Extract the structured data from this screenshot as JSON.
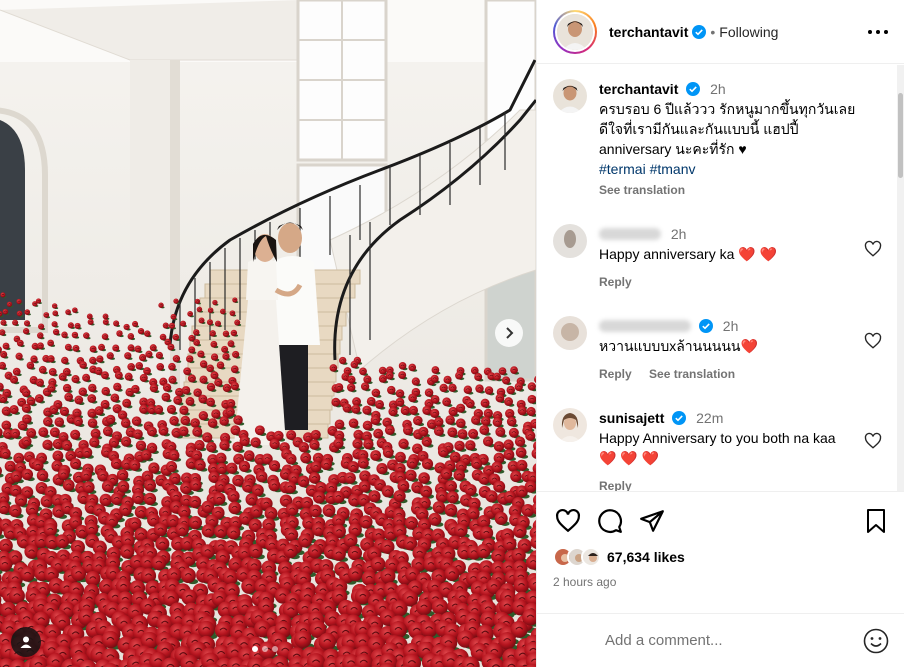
{
  "post_author": {
    "username": "terchantavit",
    "follow_status": "Following",
    "separator": "•"
  },
  "caption": {
    "username": "terchantavit",
    "time": "2h",
    "text_line1": "ครบรอบ 6 ปีแล้ววว รักหนูมากขึ้นทุกวันเลย",
    "text_line2": "ดีใจที่เรามีกันและกันแบบนี้ แฮปปี้",
    "text_line3": "anniversary นะคะที่รัก ♥",
    "hashtags": "#termai #tmanv",
    "see_translation": "See translation"
  },
  "comments": [
    {
      "time": "2h",
      "text": "Happy anniversary ka",
      "emoji": "❤️ ❤️",
      "reply": "Reply"
    },
    {
      "time": "2h",
      "text": "หวานแบบบxล้านนนนน",
      "emoji": "❤️",
      "reply": "Reply",
      "see_translation": "See translation"
    },
    {
      "username": "sunisajett",
      "time": "22m",
      "text": "Happy Anniversary to you both na kaa",
      "emoji": "❤️ ❤️ ❤️",
      "reply": "Reply"
    }
  ],
  "engagement": {
    "likes": "67,634 likes",
    "posted_ago": "2 hours ago"
  },
  "add_comment": {
    "placeholder": "Add a comment..."
  },
  "icons": {
    "verified": "verified-badge-icon",
    "more": "more-options-icon",
    "like": "heart-icon",
    "comment": "comment-icon",
    "share": "paper-plane-icon",
    "save": "bookmark-icon",
    "emoji": "emoji-icon",
    "next": "chevron-right-icon",
    "tag": "user-tag-icon"
  },
  "colors": {
    "verified_blue": "#0095f6",
    "hashtag_blue": "#00376b",
    "heart_red": "#e0152d",
    "muted_text": "#737373"
  }
}
